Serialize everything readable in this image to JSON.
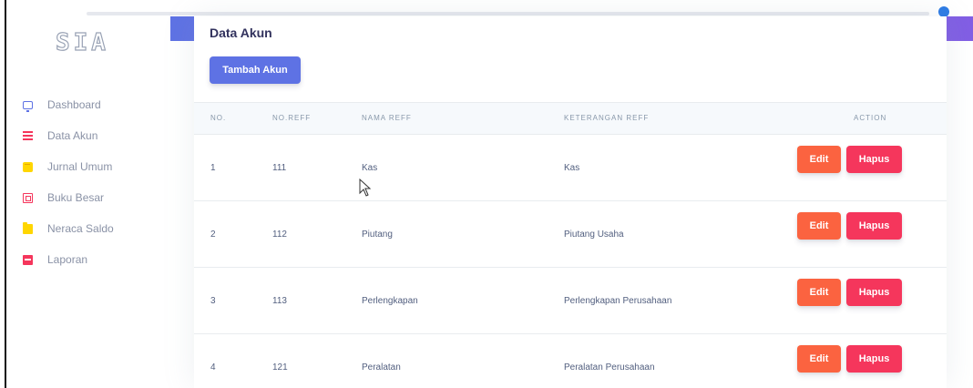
{
  "sidebar": {
    "logo_text": "SIA",
    "items": [
      {
        "label": "Dashboard",
        "icon": "monitor-icon"
      },
      {
        "label": "Data Akun",
        "icon": "list-icon"
      },
      {
        "label": "Jurnal Umum",
        "icon": "note-icon"
      },
      {
        "label": "Buku Besar",
        "icon": "book-icon"
      },
      {
        "label": "Neraca Saldo",
        "icon": "folder-icon"
      },
      {
        "label": "Laporan",
        "icon": "pdf-icon"
      }
    ]
  },
  "colors": {
    "primary": "#5e72e4",
    "edit": "#fb6340",
    "delete": "#f5365c",
    "header_gradient_end": "#825ee4"
  },
  "main": {
    "title": "Data Akun",
    "add_button": "Tambah Akun",
    "table": {
      "headers": [
        "NO.",
        "NO.REFF",
        "NAMA REFF",
        "KETERANGAN REFF",
        "ACTION"
      ],
      "rows": [
        {
          "no": "1",
          "reff": "111",
          "nama": "Kas",
          "keterangan": "Kas"
        },
        {
          "no": "2",
          "reff": "112",
          "nama": "Piutang",
          "keterangan": "Piutang Usaha"
        },
        {
          "no": "3",
          "reff": "113",
          "nama": "Perlengkapan",
          "keterangan": "Perlengkapan Perusahaan"
        },
        {
          "no": "4",
          "reff": "121",
          "nama": "Peralatan",
          "keterangan": "Peralatan Perusahaan"
        }
      ],
      "edit_label": "Edit",
      "delete_label": "Hapus"
    }
  }
}
